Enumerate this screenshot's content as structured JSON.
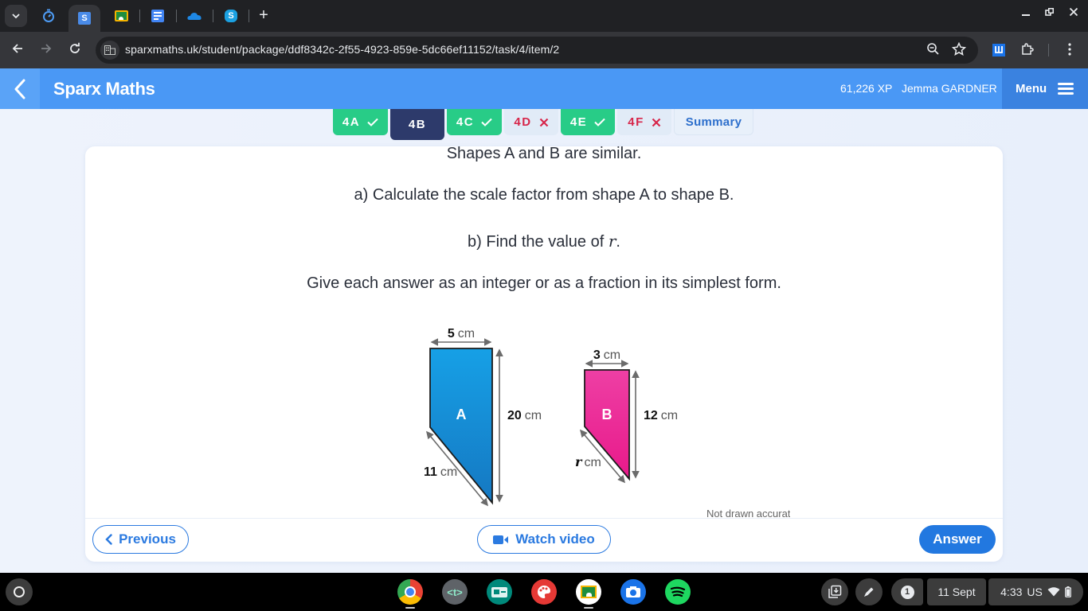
{
  "browser": {
    "tabs": [
      {
        "name": "timer",
        "icon": "stopwatch-icon",
        "active": false
      },
      {
        "name": "sparx",
        "icon": "sparx-s-icon",
        "active": true,
        "glyph": "S"
      },
      {
        "name": "classroom",
        "icon": "google-classroom-icon",
        "active": false
      },
      {
        "name": "docs",
        "icon": "google-docs-icon",
        "active": false
      },
      {
        "name": "onedrive",
        "icon": "onedrive-cloud-icon",
        "active": false
      },
      {
        "name": "skype",
        "icon": "skype-icon",
        "active": false,
        "glyph": "S"
      }
    ],
    "new_tab_glyph": "+",
    "url": "sparxmaths.uk/student/package/ddf8342c-2f55-4923-859e-5dc66ef11152/task/4/item/2"
  },
  "appbar": {
    "title": "Sparx Maths",
    "xp": "61,226 XP",
    "user": "Jemma GARDNER",
    "menu_label": "Menu"
  },
  "task_tabs": [
    {
      "label": "4A",
      "status": "correct"
    },
    {
      "label": "4B",
      "status": "current"
    },
    {
      "label": "4C",
      "status": "correct"
    },
    {
      "label": "4D",
      "status": "incorrect"
    },
    {
      "label": "4E",
      "status": "correct"
    },
    {
      "label": "4F",
      "status": "incorrect"
    },
    {
      "label": "Summary",
      "status": "summary"
    }
  ],
  "question": {
    "intro": "Shapes A and B are similar.",
    "part_a": "a) Calculate the scale factor from shape A to shape B.",
    "part_b_prefix": "b) Find the value of ",
    "part_b_var": "r",
    "part_b_suffix": ".",
    "instruction": "Give each answer as an integer or as a fraction in its simplest form."
  },
  "diagram": {
    "shape_a": {
      "label": "A",
      "top": "5",
      "side": "20",
      "slant": "11",
      "unit": "cm",
      "color": "#1a8ad6"
    },
    "shape_b": {
      "label": "B",
      "top": "3",
      "side": "12",
      "slant_var": "r",
      "unit": "cm",
      "color": "#ee2e9d"
    },
    "note": "Not drawn accurately"
  },
  "actions": {
    "previous": "Previous",
    "watch_video": "Watch video",
    "answer": "Answer"
  },
  "shelf": {
    "apps": [
      "chrome",
      "text-editor",
      "slides-reader",
      "paint",
      "google-classroom",
      "camera",
      "spotify"
    ],
    "date": "11 Sept",
    "time": "4:33",
    "locale": "US",
    "notification_count": "1"
  },
  "colors": {
    "brand": "#4a98f5",
    "correct": "#28cc87",
    "incorrect": "#d7264a",
    "current": "#2d3a6b",
    "primary_button": "#2278e0"
  }
}
